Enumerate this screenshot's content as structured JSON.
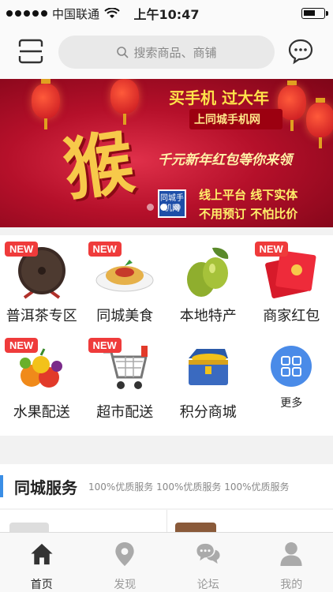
{
  "status_bar": {
    "carrier": "中国联通",
    "time": "上午10:47"
  },
  "header": {
    "search_placeholder": "搜索商品、商铺"
  },
  "banner": {
    "hou": "猴",
    "line1": "买手机  过大年",
    "line2": "上同城手机网",
    "line3": "千元新年红包等你来领",
    "line4": "线上平台 线下实体",
    "line5": "不用预订 不怕比价",
    "logo_text": "同城手机网",
    "slides": 3,
    "active_slide": 1
  },
  "categories": [
    {
      "label": "普洱茶专区",
      "new": true,
      "icon": "puer-tea-cake-icon"
    },
    {
      "label": "同城美食",
      "new": true,
      "icon": "pasta-plate-icon"
    },
    {
      "label": "本地特产",
      "new": false,
      "icon": "olives-icon"
    },
    {
      "label": "商家红包",
      "new": true,
      "icon": "red-envelope-icon"
    },
    {
      "label": "水果配送",
      "new": true,
      "icon": "fruit-basket-icon"
    },
    {
      "label": "超市配送",
      "new": true,
      "icon": "shopping-cart-icon"
    },
    {
      "label": "积分商城",
      "new": false,
      "icon": "treasure-chest-icon"
    },
    {
      "label": "更多",
      "new": false,
      "icon": "grid-more-icon"
    }
  ],
  "new_tag": "NEW",
  "service": {
    "title": "同城服务",
    "subtitle": "100%优质服务 100%优质服务 100%优质服务"
  },
  "tabs": [
    {
      "label": "首页",
      "icon": "home-icon",
      "active": true
    },
    {
      "label": "发现",
      "icon": "location-pin-icon",
      "active": false
    },
    {
      "label": "论坛",
      "icon": "chat-bubble-icon",
      "active": false
    },
    {
      "label": "我的",
      "icon": "user-icon",
      "active": false
    }
  ],
  "colors": {
    "accent_blue": "#3a8ee6",
    "new_red": "#ef3b3b",
    "more_blue": "#4a8be8"
  }
}
